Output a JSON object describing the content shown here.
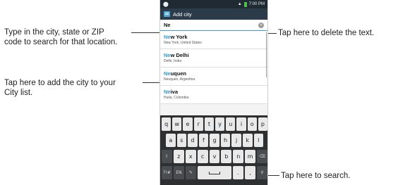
{
  "callouts": {
    "search_hint": [
      "Type in the city, state or ZIP",
      "code to search for that location."
    ],
    "add_hint": [
      "Tap here to add the city to your",
      "City list."
    ],
    "delete_hint": "Tap here to delete the text.",
    "search_key_hint": "Tap here to search."
  },
  "status": {
    "time": "7:00 PM"
  },
  "app": {
    "title": "Add city"
  },
  "search": {
    "value": "Ne"
  },
  "results": [
    {
      "match": "Ne",
      "rest": "w York",
      "sub": "New York, United States"
    },
    {
      "match": "Ne",
      "rest": "w Delhi",
      "sub": "Delhi, India"
    },
    {
      "match": "Ne",
      "rest": "uquen",
      "sub": "Neuquen, Argentina"
    },
    {
      "match": "Ne",
      "rest": "iva",
      "sub": "Huila, Colombia"
    }
  ],
  "keyboard": {
    "row1": [
      "q",
      "w",
      "e",
      "r",
      "t",
      "y",
      "u",
      "i",
      "o",
      "p"
    ],
    "row2": [
      "a",
      "s",
      "d",
      "f",
      "g",
      "h",
      "j",
      "k",
      "l"
    ],
    "row3": [
      "z",
      "x",
      "c",
      "v",
      "b",
      "n",
      "m"
    ],
    "row4_left": [
      "?!#",
      "EN",
      "✎"
    ],
    "row4_right": [
      ".",
      ",",
      "⚲"
    ]
  },
  "icons": {
    "clear": "clear-text-icon",
    "search_key": "search-icon",
    "backspace": "backspace-icon",
    "shift": "shift-icon"
  },
  "colors": {
    "accent": "#2e9ad6",
    "titlebar": "#2b3b4a",
    "keyboard": "#2d2f31"
  }
}
